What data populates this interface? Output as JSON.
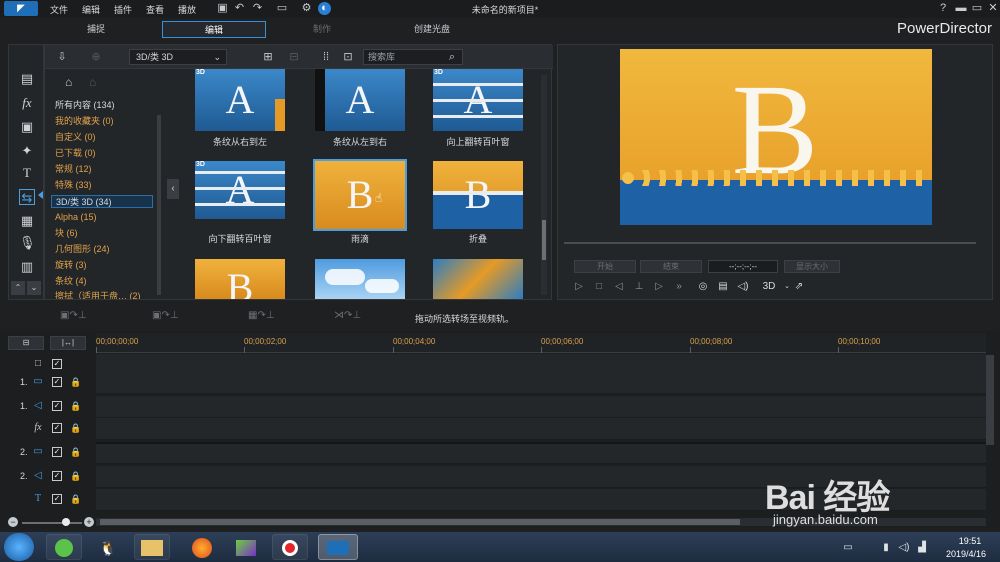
{
  "menu": {
    "items": [
      "文件",
      "编辑",
      "插件",
      "查看",
      "播放"
    ],
    "title": "未命名的新项目*"
  },
  "modes": {
    "capture": "捕捉",
    "edit": "编辑",
    "produce": "制作",
    "disc": "创建光盘"
  },
  "brand": "PowerDirector",
  "library": {
    "dropdown": "3D/类 3D",
    "search_placeholder": "搜索库",
    "categories": [
      {
        "label": "所有内容 (134)"
      },
      {
        "label": "我的收藏夹 (0)"
      },
      {
        "label": "自定义 (0)"
      },
      {
        "label": "已下载 (0)"
      },
      {
        "label": "常规 (12)"
      },
      {
        "label": "特殊 (33)"
      },
      {
        "label": "3D/类 3D (34)"
      },
      {
        "label": "Alpha (15)"
      },
      {
        "label": "块 (6)"
      },
      {
        "label": "几何图形 (24)"
      },
      {
        "label": "旋转 (3)"
      },
      {
        "label": "条纹 (4)"
      },
      {
        "label": "擦拭（适用于盘… (2)"
      }
    ],
    "thumbnails": [
      {
        "label": "条纹从右到左",
        "letter": "A"
      },
      {
        "label": "条纹从左到右",
        "letter": "A"
      },
      {
        "label": "向上翻转百叶窗",
        "letter": "A"
      },
      {
        "label": "向下翻转百叶窗",
        "letter": "A"
      },
      {
        "label": "雨滴",
        "letter": "B"
      },
      {
        "label": "折叠",
        "letter": "B"
      },
      {
        "label": "",
        "letter": "B"
      },
      {
        "label": "",
        "letter": ""
      },
      {
        "label": "",
        "letter": ""
      }
    ],
    "tag_3d": "3D"
  },
  "preview": {
    "letter": "B",
    "btn_mark_in": "开始",
    "btn_mark_out": "结束",
    "timecode": "--;--;--;--",
    "btn_size": "显示大小",
    "mode_3d": "3D"
  },
  "timeline": {
    "hint": "拖动所选转场至视频轨。",
    "ticks": [
      "00;00;00;00",
      "00;00;02;00",
      "00;00;04;00",
      "00;00;06;00",
      "00;00;08;00",
      "00;00;10;00"
    ],
    "tracks": [
      {
        "num": "",
        "icon": "□"
      },
      {
        "num": "1.",
        "icon": "▭"
      },
      {
        "num": "1.",
        "icon": "◁"
      },
      {
        "num": "",
        "icon": "fx"
      },
      {
        "num": "2.",
        "icon": "▭"
      },
      {
        "num": "2.",
        "icon": "◁"
      },
      {
        "num": "",
        "icon": "T"
      }
    ]
  },
  "taskbar": {
    "time": "19:51",
    "date": "2019/4/16"
  },
  "watermark": {
    "text": "Bai  经验",
    "url": "jingyan.baidu.com"
  }
}
